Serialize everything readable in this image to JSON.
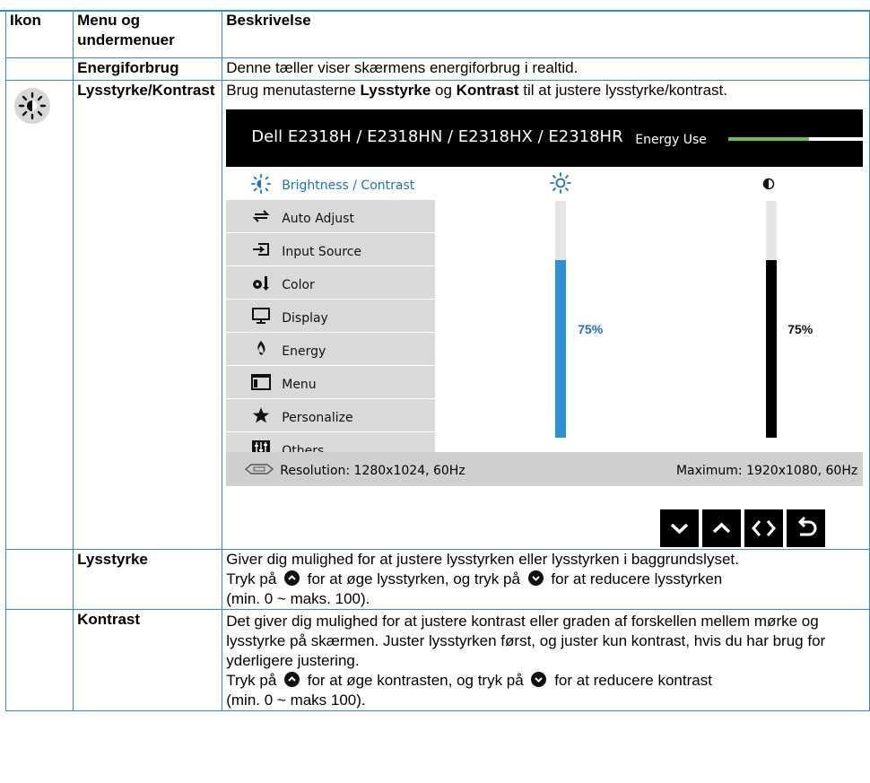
{
  "table": {
    "headers": [
      "Ikon",
      "Menu og undermenuer",
      "Beskrivelse"
    ],
    "rows": {
      "energy": {
        "menu": "Energiforbrug",
        "desc": "Denne tæller viser skærmens energiforbrug i realtid."
      },
      "brightness_contrast": {
        "menu": "Lysstyrke/Kontrast",
        "desc_pre": "Brug menutasterne ",
        "desc_b1": "Lysstyrke",
        "desc_mid": " og ",
        "desc_b2": "Kontrast",
        "desc_post": " til at justere lysstyrke/kontrast."
      },
      "brightness": {
        "menu": "Lysstyrke",
        "line1": "Giver dig mulighed for at justere lysstyrken eller lysstyrken i baggrundslyset.",
        "line2_pre": "Tryk på",
        "line2_mid": "for at øge lysstyrken, og tryk på",
        "line2_post": "for at reducere lysstyrken",
        "line3": "(min. 0 ~ maks. 100)."
      },
      "contrast": {
        "menu": "Kontrast",
        "line1": "Det giver dig mulighed for at justere kontrast eller graden af forskellen mellem mørke og lysstyrke på skærmen. Juster lysstyrken først, og juster kun kontrast, hvis du har brug for yderligere justering.",
        "line2_pre": "Tryk på",
        "line2_mid": "for at øge kontrasten, og tryk på",
        "line2_post": "for at reducere kontrast",
        "line3": "(min. 0 ~ maks 100)."
      }
    }
  },
  "osd": {
    "model": "Dell E2318H / E2318HN / E2318HX / E2318HR",
    "energy_label": "Energy Use",
    "energy_level": 0.6,
    "menu": [
      {
        "label": "Brightness / Contrast",
        "icon": "sun-icon",
        "active": true
      },
      {
        "label": "Auto Adjust",
        "icon": "auto-adjust-icon"
      },
      {
        "label": "Input Source",
        "icon": "input-source-icon"
      },
      {
        "label": "Color",
        "icon": "color-icon"
      },
      {
        "label": "Display",
        "icon": "display-icon"
      },
      {
        "label": "Energy",
        "icon": "energy-icon"
      },
      {
        "label": "Menu",
        "icon": "menu-icon"
      },
      {
        "label": "Personalize",
        "icon": "star-icon"
      },
      {
        "label": "Others",
        "icon": "others-icon"
      }
    ],
    "brightness_pct": "75%",
    "brightness_value": 75,
    "contrast_pct": "75%",
    "contrast_value": 75,
    "resolution": "Resolution: 1280x1024, 60Hz",
    "maximum": "Maximum: 1920x1080, 60Hz",
    "colors": {
      "accent": "#1a72c4",
      "energy": "#6cc04a",
      "border": "#2f8fc7"
    }
  }
}
